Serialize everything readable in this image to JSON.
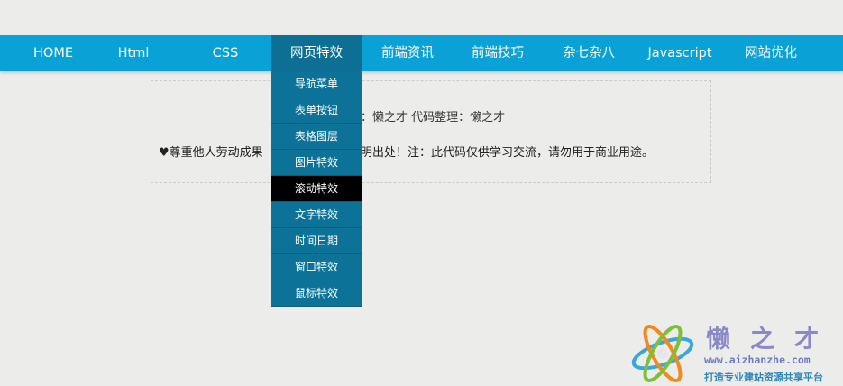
{
  "nav": {
    "items": [
      {
        "label": "HOME"
      },
      {
        "label": "Html"
      },
      {
        "label": "CSS"
      },
      {
        "label": "网页特效"
      },
      {
        "label": "前端资讯"
      },
      {
        "label": "前端技巧"
      },
      {
        "label": "杂七杂八"
      },
      {
        "label": "Javascript"
      },
      {
        "label": "网站优化"
      }
    ],
    "active_label": "网页特效"
  },
  "dropdown": {
    "items": [
      {
        "label": "导航菜单"
      },
      {
        "label": "表单按钮"
      },
      {
        "label": "表格图层"
      },
      {
        "label": "图片特效"
      },
      {
        "label": "滚动特效"
      },
      {
        "label": "文字特效"
      },
      {
        "label": "时间日期"
      },
      {
        "label": "窗口特效"
      },
      {
        "label": "鼠标特效"
      }
    ],
    "highlighted_label": "滚动特效"
  },
  "content": {
    "credits_text": "：懒之才    代码整理：懒之才",
    "notice_left": "♥尊重他人劳动成果",
    "notice_right": "明出处！注：此代码仅供学习交流，请勿用于商业用途。"
  },
  "watermark": {
    "title": "懒之才",
    "url": "www.aizhanzhe.com",
    "slogan": "打造专业建站资源共享平台"
  },
  "colors": {
    "nav_bg": "#0aa2d6",
    "nav_active_bg": "#0c6f93",
    "dropdown_bg": "#0d7298",
    "dropdown_hover_bg": "#000000",
    "page_bg": "#ececea"
  }
}
